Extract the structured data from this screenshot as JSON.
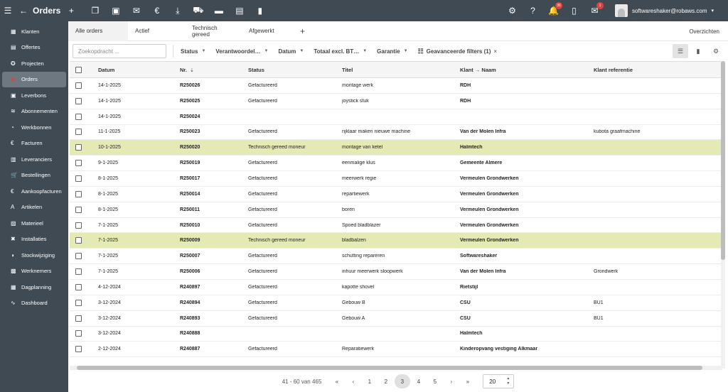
{
  "topbar": {
    "menu_icon": "menu-icon",
    "back_icon": "arrow-left-icon",
    "title": "Orders",
    "add_icon": "plus-icon",
    "tools": [
      "copy-icon",
      "image-icon",
      "mail-icon",
      "euro-icon",
      "download-icon",
      "cart-icon",
      "trash-icon",
      "archive-icon",
      "lock-icon"
    ],
    "settings_icon": "gear-icon",
    "help_icon": "help-icon",
    "notifications_badge": "36",
    "clipboard_icon": "clipboard-icon",
    "messages_badge": "1",
    "user_email": "softwareshaker@robaws.com"
  },
  "sidebar": {
    "items": [
      {
        "label": "Klanten",
        "icon": "people-icon",
        "glyph": "▦"
      },
      {
        "label": "Offertes",
        "icon": "document-icon",
        "glyph": "▤"
      },
      {
        "label": "Projecten",
        "icon": "project-icon",
        "glyph": "✪"
      },
      {
        "label": "Orders",
        "icon": "orders-icon",
        "glyph": "◉",
        "active": true
      },
      {
        "label": "Leverbons",
        "icon": "delivery-icon",
        "glyph": "▣"
      },
      {
        "label": "Abonnementen",
        "icon": "subscription-icon",
        "glyph": "≋"
      },
      {
        "label": "Werkbonnen",
        "icon": "timer-icon",
        "glyph": "◔"
      },
      {
        "label": "Facturen",
        "icon": "invoice-icon",
        "glyph": "€"
      },
      {
        "label": "Leveranciers",
        "icon": "supplier-icon",
        "glyph": "▥"
      },
      {
        "label": "Bestellingen",
        "icon": "cart-icon",
        "glyph": "🛒"
      },
      {
        "label": "Aankoopfacturen",
        "icon": "purchase-invoice-icon",
        "glyph": "€"
      },
      {
        "label": "Artikelen",
        "icon": "article-icon",
        "glyph": "A"
      },
      {
        "label": "Materieel",
        "icon": "equipment-icon",
        "glyph": "▨"
      },
      {
        "label": "Installaties",
        "icon": "tools-icon",
        "glyph": "✖"
      },
      {
        "label": "Stockwijziging",
        "icon": "stock-icon",
        "glyph": "◑"
      },
      {
        "label": "Werknemers",
        "icon": "employees-icon",
        "glyph": "▩"
      },
      {
        "label": "Dagplanning",
        "icon": "calendar-icon",
        "glyph": "▦"
      },
      {
        "label": "Dashboard",
        "icon": "trend-icon",
        "glyph": "∿"
      }
    ]
  },
  "tabs": {
    "items": [
      "Alle orders",
      "Actief",
      "Technisch gereed",
      "Afgewerkt"
    ],
    "add_label": "+",
    "overviews_label": "Overzichten"
  },
  "filters": {
    "search_placeholder": "Zoekopdracht ...",
    "items": [
      "Status",
      "Verantwoordel…",
      "Datum",
      "Totaal excl. BT…",
      "Garantie"
    ],
    "advanced_label": "Geavanceerde filters (1)",
    "advanced_close": "×"
  },
  "table": {
    "headers": {
      "date": "Datum",
      "nr": "Nr.",
      "status": "Status",
      "title": "Titel",
      "klant": "Klant → Naam",
      "ref": "Klant referentie"
    },
    "rows": [
      {
        "date": "14-1-2025",
        "nr": "R250026",
        "status": "Gefactureerd",
        "title": "montage werk",
        "klant": "RDH",
        "ref": ""
      },
      {
        "date": "14-1-2025",
        "nr": "R250025",
        "status": "Gefactureerd",
        "title": "joystick stuk",
        "klant": "RDH",
        "ref": ""
      },
      {
        "date": "14-1-2025",
        "nr": "R250024",
        "status": "",
        "title": "",
        "klant": "",
        "ref": ""
      },
      {
        "date": "11-1-2025",
        "nr": "R250023",
        "status": "Gefactureerd",
        "title": "rijklaar maken nieuwe machine",
        "klant": "Van der Molen Infra",
        "ref": "kubota graafmachine"
      },
      {
        "date": "10-1-2025",
        "nr": "R250020",
        "status": "Technisch gereed moneur",
        "title": "montage van ketel",
        "klant": "Halmtech",
        "ref": "",
        "hl": true
      },
      {
        "date": "9-1-2025",
        "nr": "R250019",
        "status": "Gefactureerd",
        "title": "eenmalige klus",
        "klant": "Gemeente Almere",
        "ref": ""
      },
      {
        "date": "8-1-2025",
        "nr": "R250017",
        "status": "Gefactureerd",
        "title": "meerwerk regie",
        "klant": "Vermeulen Grondwerken",
        "ref": ""
      },
      {
        "date": "8-1-2025",
        "nr": "R250014",
        "status": "Gefactureerd",
        "title": "repartiewerk",
        "klant": "Vermeulen Grondwerken",
        "ref": ""
      },
      {
        "date": "8-1-2025",
        "nr": "R250011",
        "status": "Gefactureerd",
        "title": "boren",
        "klant": "Vermeulen Grondwerken",
        "ref": ""
      },
      {
        "date": "7-1-2025",
        "nr": "R250010",
        "status": "Gefactureerd",
        "title": "Spoed bladblazer",
        "klant": "Vermeulen Grondwerken",
        "ref": ""
      },
      {
        "date": "7-1-2025",
        "nr": "R250009",
        "status": "Technisch gereed moneur",
        "title": "bladbalzen",
        "klant": "Vermeulen Grondwerken",
        "ref": "",
        "hl": true
      },
      {
        "date": "7-1-2025",
        "nr": "R250007",
        "status": "Gefactureerd",
        "title": "schutting repareren",
        "klant": "Softwareshaker",
        "ref": ""
      },
      {
        "date": "7-1-2025",
        "nr": "R250006",
        "status": "Gefactureerd",
        "title": "inhuur meerwerk sloopwerk",
        "klant": "Van der Molen Infra",
        "ref": "Grondwerk"
      },
      {
        "date": "4-12-2024",
        "nr": "R240897",
        "status": "Gefactureerd",
        "title": "kapotte shovel",
        "klant": "Rietstijl",
        "ref": ""
      },
      {
        "date": "3-12-2024",
        "nr": "R240894",
        "status": "Gefactureerd",
        "title": "Gebouw B",
        "klant": "CSU",
        "ref": "BU1"
      },
      {
        "date": "3-12-2024",
        "nr": "R240893",
        "status": "Gefactureerd",
        "title": "Gebouw A",
        "klant": "CSU",
        "ref": "BU1"
      },
      {
        "date": "3-12-2024",
        "nr": "R240888",
        "status": "",
        "title": "",
        "klant": "Halmtech",
        "ref": ""
      },
      {
        "date": "2-12-2024",
        "nr": "R240887",
        "status": "Gefactureerd",
        "title": "Reparatiewerk",
        "klant": "Kinderopvang vestiging Alkmaar",
        "ref": ""
      }
    ]
  },
  "pager": {
    "info": "41 - 60 van 465",
    "first": "«",
    "prev": "‹",
    "pages": [
      "1",
      "2",
      "3",
      "4",
      "5"
    ],
    "current": "3",
    "next": "›",
    "last": "»",
    "page_size": "20"
  },
  "colors": {
    "bar": "#3f4a52",
    "highlight": "#e5eab4",
    "badge": "#e0433c"
  }
}
